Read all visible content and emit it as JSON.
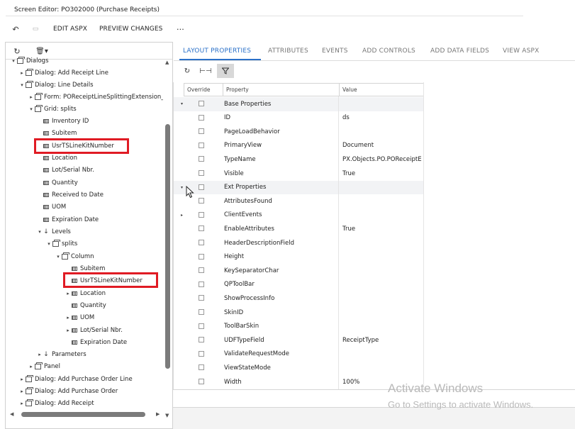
{
  "window": {
    "title": "Screen Editor: PO302000 (Purchase Receipts)"
  },
  "toolbar": {
    "undo_icon": "undo-icon",
    "save_icon": "save-icon",
    "edit_aspx": "EDIT ASPX",
    "preview_changes": "PREVIEW CHANGES",
    "more": "..."
  },
  "left_toolbar": {
    "refresh_icon": "refresh-icon",
    "delete_icon": "trash-icon"
  },
  "tree": {
    "items": [
      {
        "label": "Dialogs",
        "type": "dialog",
        "expanded": true
      },
      {
        "label": "Dialog: Add Receipt Line",
        "type": "dialog",
        "expanded": false
      },
      {
        "label": "Dialog: Line Details",
        "type": "dialog",
        "expanded": true
      },
      {
        "label": "Form: POReceiptLineSplittingExtension_",
        "type": "dialog",
        "expanded": false
      },
      {
        "label": "Grid: splits",
        "type": "dialog",
        "expanded": true
      },
      {
        "label": "Inventory ID",
        "type": "field"
      },
      {
        "label": "Subitem",
        "type": "field"
      },
      {
        "label": "UsrTSLineKitNumber",
        "type": "field",
        "highlighted": true
      },
      {
        "label": "Location",
        "type": "field"
      },
      {
        "label": "Lot/Serial Nbr.",
        "type": "field"
      },
      {
        "label": "Quantity",
        "type": "field"
      },
      {
        "label": "Received to Date",
        "type": "field"
      },
      {
        "label": "UOM",
        "type": "field"
      },
      {
        "label": "Expiration Date",
        "type": "field"
      },
      {
        "label": "Levels",
        "type": "level",
        "expanded": true
      },
      {
        "label": "splits",
        "type": "dialog",
        "expanded": true
      },
      {
        "label": "Column",
        "type": "dialog",
        "expanded": true
      },
      {
        "label": "Subitem",
        "type": "field"
      },
      {
        "label": "UsrTSLineKitNumber",
        "type": "field",
        "highlighted": true
      },
      {
        "label": "Location",
        "type": "field",
        "expanded": false
      },
      {
        "label": "Quantity",
        "type": "field"
      },
      {
        "label": "UOM",
        "type": "field",
        "expanded": false
      },
      {
        "label": "Lot/Serial Nbr.",
        "type": "field",
        "expanded": false
      },
      {
        "label": "Expiration Date",
        "type": "field"
      },
      {
        "label": "Parameters",
        "type": "level",
        "expanded": false
      },
      {
        "label": "Panel",
        "type": "dialog",
        "expanded": false
      },
      {
        "label": "Dialog: Add Purchase Order Line",
        "type": "dialog",
        "expanded": false
      },
      {
        "label": "Dialog: Add Purchase Order",
        "type": "dialog",
        "expanded": false
      },
      {
        "label": "Dialog: Add Receipt",
        "type": "dialog",
        "expanded": false
      }
    ]
  },
  "tabs": [
    {
      "label": "LAYOUT PROPERTIES",
      "active": true
    },
    {
      "label": "ATTRIBUTES"
    },
    {
      "label": "EVENTS"
    },
    {
      "label": "ADD CONTROLS"
    },
    {
      "label": "ADD DATA FIELDS"
    },
    {
      "label": "VIEW ASPX"
    }
  ],
  "right_toolbar": {
    "refresh_icon": "refresh-icon",
    "fit_icon": "fit-width-icon",
    "filter_icon": "filter-icon"
  },
  "grid": {
    "columns": [
      "Override",
      "Property",
      "Value"
    ],
    "rows": [
      {
        "property": "Base Properties",
        "value": "",
        "group": true,
        "expanded": true
      },
      {
        "property": "ID",
        "value": "ds"
      },
      {
        "property": "PageLoadBehavior",
        "value": ""
      },
      {
        "property": "PrimaryView",
        "value": "Document"
      },
      {
        "property": "TypeName",
        "value": "PX.Objects.PO.POReceiptEntry"
      },
      {
        "property": "Visible",
        "value": "True"
      },
      {
        "property": "Ext Properties",
        "value": "",
        "group": true,
        "expanded": true
      },
      {
        "property": "AttributesFound",
        "value": ""
      },
      {
        "property": "ClientEvents",
        "value": "",
        "expandable": true
      },
      {
        "property": "EnableAttributes",
        "value": "True"
      },
      {
        "property": "HeaderDescriptionField",
        "value": ""
      },
      {
        "property": "Height",
        "value": ""
      },
      {
        "property": "KeySeparatorChar",
        "value": ""
      },
      {
        "property": "QPToolBar",
        "value": ""
      },
      {
        "property": "ShowProcessInfo",
        "value": ""
      },
      {
        "property": "SkinID",
        "value": ""
      },
      {
        "property": "ToolBarSkin",
        "value": ""
      },
      {
        "property": "UDFTypeField",
        "value": "ReceiptType"
      },
      {
        "property": "ValidateRequestMode",
        "value": ""
      },
      {
        "property": "ViewStateMode",
        "value": ""
      },
      {
        "property": "Width",
        "value": "100%"
      }
    ]
  },
  "watermark": {
    "line1": "Activate Windows",
    "line2": "Go to Settings to activate Windows."
  },
  "colors": {
    "accent": "#2a70c8",
    "highlight": "#e01b24",
    "group_bg": "#f2f3f5"
  }
}
